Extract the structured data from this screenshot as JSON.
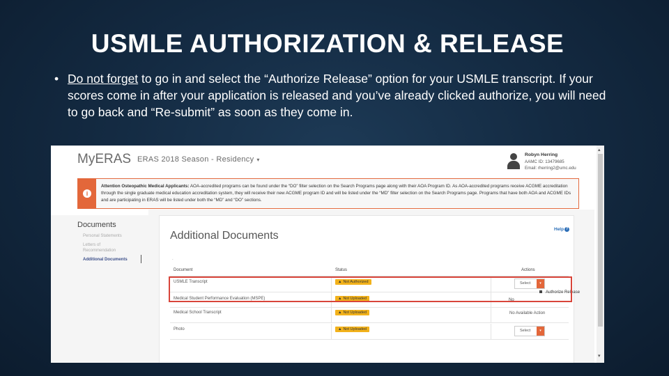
{
  "slide": {
    "title": "USMLE AUTHORIZATION & RELEASE",
    "bullet_symbol": "•",
    "bullet_underlined": "Do not forget",
    "bullet_rest": " to go in and select the “Authorize Release” option for your USMLE transcript.  If your scores come in after your application is released and you’ve already clicked authorize, you will need to go back and “Re-submit” as soon as they come in."
  },
  "app": {
    "logo": "MyERAS",
    "season": "ERAS 2018 Season - Residency",
    "season_caret": "▾",
    "user": {
      "name": "Robyn Herring",
      "aamc_id": "AAMC ID: 13479685",
      "email": "Email: rherring2@umc.edu"
    },
    "alert": {
      "icon": "i",
      "heading": "Attention Osteopathic Medical Applicants:",
      "text": " AOA-accredited programs can be found under the “DO” filter selection on the Search Programs page along with their AOA Program ID. As AOA-accredited programs receive ACGME accreditation through the single graduate medical education accreditation system, they will receive their new ACGME program ID and will be listed under the “MD” filter selection on the Search Programs page. Programs that have both AOA and ACGME IDs and are participating in ERAS will be listed under both the “MD” and “DO” sections."
    },
    "sidebar": {
      "title": "Documents",
      "items": [
        {
          "label": "Personal Statements"
        },
        {
          "label": "Letters of Recommendation"
        },
        {
          "label": "Additional Documents"
        }
      ]
    },
    "panel": {
      "title": "Additional Documents",
      "help": "Help",
      "help_icon": "?",
      "marker": "."
    },
    "table": {
      "headers": [
        "Document",
        "Status",
        "Actions"
      ],
      "rows": [
        {
          "document": "USMLE Transcript",
          "status": "Not Authorized",
          "action": "Select"
        },
        {
          "document": "Medical Student Performance Evaluation (MSPE)",
          "status": "Not Uploaded",
          "action": ""
        },
        {
          "document": "Medical School Transcript",
          "status": "Not Uploaded",
          "action": "No Available Action"
        },
        {
          "document": "Photo",
          "status": "Not Uploaded",
          "action": "Select"
        }
      ],
      "warn_icon": "▲",
      "dropdown_arrow": "▾",
      "menu_item": "Authorize Release",
      "row2_action_fragment": "No"
    },
    "scroll": {
      "up": "▴",
      "down": "▾"
    }
  }
}
